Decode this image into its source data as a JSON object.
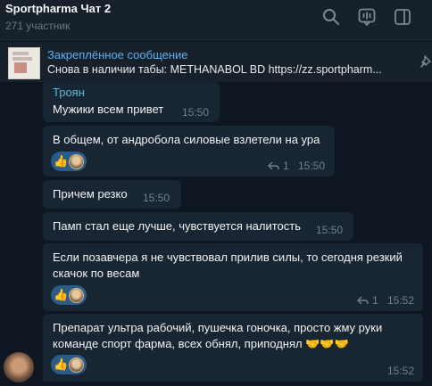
{
  "header": {
    "title": "Sportpharma Чат 2",
    "subtitle": "271 участник"
  },
  "pinned": {
    "label": "Закреплённое сообщение",
    "text": "Снова в наличии табы: METHANABOL BD https://zz.sportpharm..."
  },
  "messages": [
    {
      "sender": "Троян",
      "lines": [
        "Мужики всем привет"
      ],
      "time": "15:50"
    },
    {
      "lines": [
        "В общем, от андробола силовые взлетели на ура"
      ],
      "reactions": [
        "👍"
      ],
      "replies": "1",
      "time": "15:50"
    },
    {
      "lines": [
        "Причем резко"
      ],
      "time": "15:50"
    },
    {
      "lines": [
        "Памп стал еще лучше, чувствуется налитость"
      ],
      "time": "15:50"
    },
    {
      "lines": [
        "Если позавчера я не чувствовал прилив силы, то сегодня резкий",
        "скачок по весам"
      ],
      "reactions": [
        "👍"
      ],
      "replies": "1",
      "time": "15:52"
    },
    {
      "lines": [
        "Препарат ультра рабочий, пушечка гоночка, просто жму руки",
        "команде спорт фарма, всех обнял, приподнял 🤝🤝🤝"
      ],
      "reactions": [
        "👍"
      ],
      "time": "15:52"
    }
  ]
}
